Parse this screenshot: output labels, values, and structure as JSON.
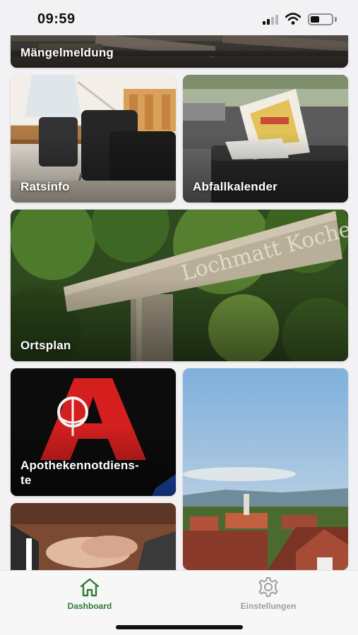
{
  "status_bar": {
    "time": "09:59"
  },
  "colors": {
    "accent": "#2e7d32",
    "inactive": "#9e9e9e",
    "background": "#f2f2f4"
  },
  "tiles": [
    {
      "id": "maengelmeldung",
      "label": "Mängelmeldung",
      "icon": "wooden-planks-image"
    },
    {
      "id": "ratsinfo",
      "label": "Ratsinfo",
      "icon": "conference-room-image"
    },
    {
      "id": "abfallkalender",
      "label": "Abfallkalender",
      "icon": "trash-bin-image"
    },
    {
      "id": "ortsplan",
      "label": "Ortsplan",
      "icon": "wooden-signpost-image",
      "sign_text": "Lochmatt Kochenweg"
    },
    {
      "id": "apothekennotdienste",
      "label": "Apothekennotdiens-\nte",
      "icon": "pharmacy-sign-image"
    },
    {
      "id": "town-view",
      "label": "",
      "icon": "town-panorama-image"
    },
    {
      "id": "handshake",
      "label": "",
      "icon": "handshake-image"
    }
  ],
  "tabbar": {
    "items": [
      {
        "label": "Dashboard",
        "icon": "home-icon",
        "active": true
      },
      {
        "label": "Einstellungen",
        "icon": "gear-icon",
        "active": false
      }
    ]
  }
}
